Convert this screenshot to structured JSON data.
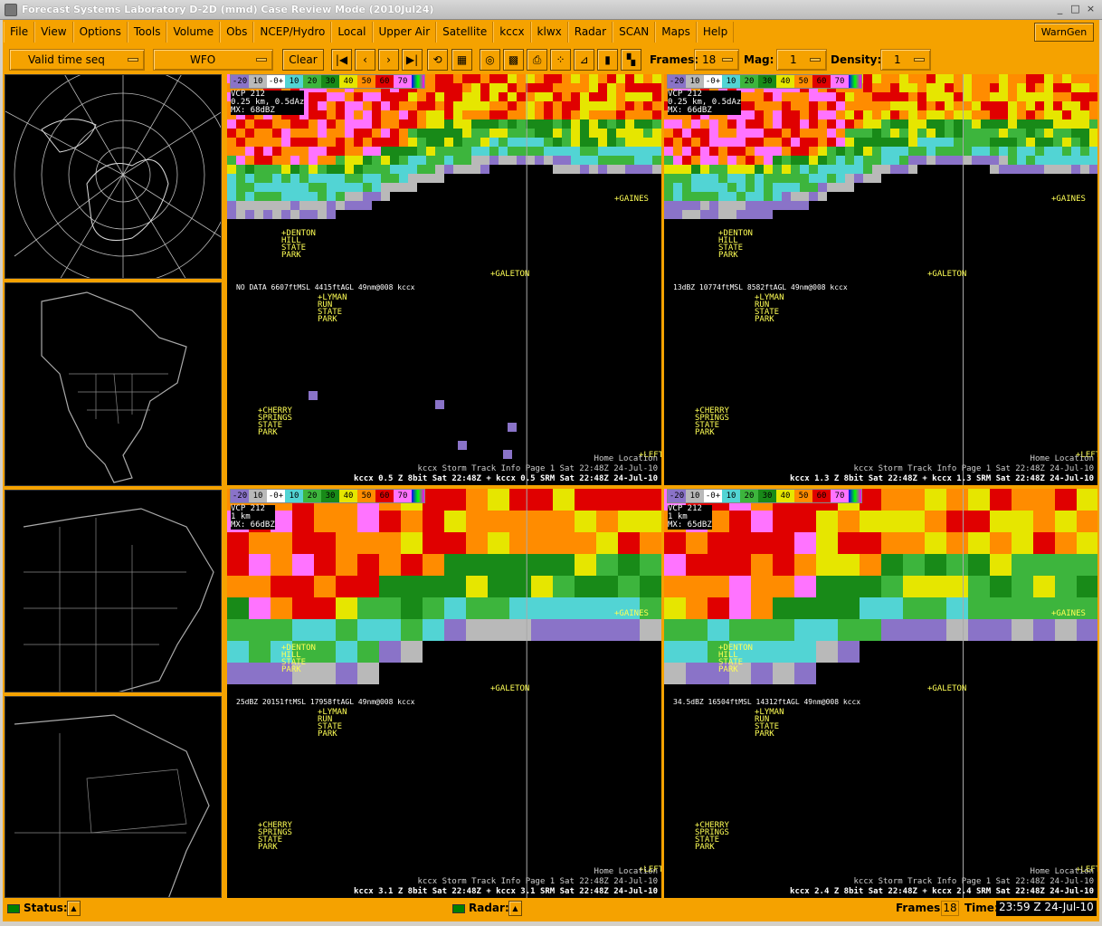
{
  "window": {
    "title": "Forecast Systems Laboratory D-2D (mmd) Case Review Mode (2010Jul24)"
  },
  "menu": [
    "File",
    "View",
    "Options",
    "Tools",
    "Volume",
    "Obs",
    "NCEP/Hydro",
    "Local",
    "Upper Air",
    "Satellite",
    "kccx",
    "klwx",
    "Radar",
    "SCAN",
    "Maps",
    "Help"
  ],
  "wamgen": "WarnGen",
  "toolbar": {
    "time_mode": "Valid time seq",
    "scale": "WFO",
    "clear": "Clear",
    "frames_label": "Frames:",
    "frames_value": "18",
    "mag_label": "Mag:",
    "mag_value": "1",
    "density_label": "Density:",
    "density_value": "1"
  },
  "colorbar": {
    "labels": [
      "-20",
      "10",
      "-0+",
      "10",
      "20",
      "30",
      "40",
      "50",
      "60",
      "70"
    ],
    "colors": [
      "#8a73c8",
      "#b9b9b9",
      "#ffffff",
      "#52d4d4",
      "#3db53d",
      "#188a18",
      "#e6e600",
      "#ff8c00",
      "#e00000",
      "#ff73ff"
    ]
  },
  "places": {
    "gaines": "GAINES",
    "denton": "DENTON\nHILL\nSTATE\nPARK",
    "galeton": "GALETON",
    "lyman": "LYMAN\nRUN\nSTATE\nPARK",
    "cherry": "CHERRY\nSPRINGS\nSTATE\nPARK",
    "left": "LEFT"
  },
  "panels": [
    {
      "vcp": "VCP 212",
      "res": "0.25 km, 0.5dAz",
      "mx": "MX: 68dBZ",
      "sample": "NO DATA 6607ftMSL 4415ftAGL 49nm@008 kccx",
      "home": "Home Location",
      "track": "kccx Storm Track Info Page 1  Sat 22:48Z 24-Jul-10",
      "bottom": "kccx 0.5 Z  8bit Sat 22:48Z + kccx 0.5 SRM Sat 22:48Z 24-Jul-10"
    },
    {
      "vcp": "VCP 212",
      "res": "0.25 km, 0.5dAz",
      "mx": "MX: 66dBZ",
      "sample": "13dBZ 10774ftMSL 8582ftAGL 49nm@008 kccx",
      "home": "Home Location",
      "track": "kccx Storm Track Info Page 1  Sat 22:48Z 24-Jul-10",
      "bottom": "kccx 1.3 Z  8bit Sat 22:48Z + kccx 1.3 SRM Sat 22:48Z 24-Jul-10"
    },
    {
      "vcp": "VCP 212",
      "res": "1 km",
      "mx": "MX: 66dBZ",
      "sample": "25dBZ 20151ftMSL 17958ftAGL 49nm@008 kccx",
      "home": "Home Location",
      "track": "kccx Storm Track Info Page 1  Sat 22:48Z 24-Jul-10",
      "bottom": "kccx 3.1 Z  8bit Sat 22:48Z + kccx 3.1 SRM Sat 22:48Z 24-Jul-10"
    },
    {
      "vcp": "VCP 212",
      "res": "1 km",
      "mx": "MX: 65dBZ",
      "sample": "34.5dBZ 16504ftMSL 14312ftAGL 49nm@008 kccx",
      "home": "Home Location",
      "track": "kccx Storm Track Info Page 1  Sat 22:48Z 24-Jul-10",
      "bottom": "kccx 2.4 Z  8bit Sat 22:48Z + kccx 2.4 SRM Sat 22:48Z 24-Jul-10"
    }
  ],
  "status": {
    "status_label": "Status:",
    "radar_label": "Radar:",
    "frames_label": "Frames:",
    "frames_value": "18",
    "time_label": "Time:",
    "time_value": "23:59 Z 24-Jul-10"
  }
}
